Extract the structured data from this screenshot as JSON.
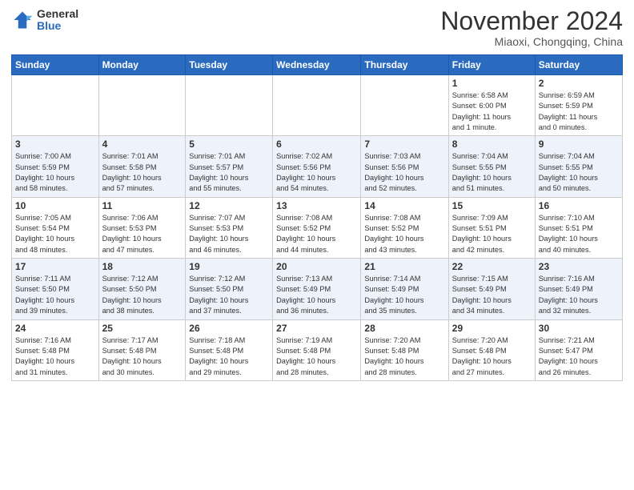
{
  "header": {
    "logo_general": "General",
    "logo_blue": "Blue",
    "title": "November 2024",
    "location": "Miaoxi, Chongqing, China"
  },
  "weekdays": [
    "Sunday",
    "Monday",
    "Tuesday",
    "Wednesday",
    "Thursday",
    "Friday",
    "Saturday"
  ],
  "weeks": [
    [
      {
        "day": "",
        "info": ""
      },
      {
        "day": "",
        "info": ""
      },
      {
        "day": "",
        "info": ""
      },
      {
        "day": "",
        "info": ""
      },
      {
        "day": "",
        "info": ""
      },
      {
        "day": "1",
        "info": "Sunrise: 6:58 AM\nSunset: 6:00 PM\nDaylight: 11 hours\nand 1 minute."
      },
      {
        "day": "2",
        "info": "Sunrise: 6:59 AM\nSunset: 5:59 PM\nDaylight: 11 hours\nand 0 minutes."
      }
    ],
    [
      {
        "day": "3",
        "info": "Sunrise: 7:00 AM\nSunset: 5:59 PM\nDaylight: 10 hours\nand 58 minutes."
      },
      {
        "day": "4",
        "info": "Sunrise: 7:01 AM\nSunset: 5:58 PM\nDaylight: 10 hours\nand 57 minutes."
      },
      {
        "day": "5",
        "info": "Sunrise: 7:01 AM\nSunset: 5:57 PM\nDaylight: 10 hours\nand 55 minutes."
      },
      {
        "day": "6",
        "info": "Sunrise: 7:02 AM\nSunset: 5:56 PM\nDaylight: 10 hours\nand 54 minutes."
      },
      {
        "day": "7",
        "info": "Sunrise: 7:03 AM\nSunset: 5:56 PM\nDaylight: 10 hours\nand 52 minutes."
      },
      {
        "day": "8",
        "info": "Sunrise: 7:04 AM\nSunset: 5:55 PM\nDaylight: 10 hours\nand 51 minutes."
      },
      {
        "day": "9",
        "info": "Sunrise: 7:04 AM\nSunset: 5:55 PM\nDaylight: 10 hours\nand 50 minutes."
      }
    ],
    [
      {
        "day": "10",
        "info": "Sunrise: 7:05 AM\nSunset: 5:54 PM\nDaylight: 10 hours\nand 48 minutes."
      },
      {
        "day": "11",
        "info": "Sunrise: 7:06 AM\nSunset: 5:53 PM\nDaylight: 10 hours\nand 47 minutes."
      },
      {
        "day": "12",
        "info": "Sunrise: 7:07 AM\nSunset: 5:53 PM\nDaylight: 10 hours\nand 46 minutes."
      },
      {
        "day": "13",
        "info": "Sunrise: 7:08 AM\nSunset: 5:52 PM\nDaylight: 10 hours\nand 44 minutes."
      },
      {
        "day": "14",
        "info": "Sunrise: 7:08 AM\nSunset: 5:52 PM\nDaylight: 10 hours\nand 43 minutes."
      },
      {
        "day": "15",
        "info": "Sunrise: 7:09 AM\nSunset: 5:51 PM\nDaylight: 10 hours\nand 42 minutes."
      },
      {
        "day": "16",
        "info": "Sunrise: 7:10 AM\nSunset: 5:51 PM\nDaylight: 10 hours\nand 40 minutes."
      }
    ],
    [
      {
        "day": "17",
        "info": "Sunrise: 7:11 AM\nSunset: 5:50 PM\nDaylight: 10 hours\nand 39 minutes."
      },
      {
        "day": "18",
        "info": "Sunrise: 7:12 AM\nSunset: 5:50 PM\nDaylight: 10 hours\nand 38 minutes."
      },
      {
        "day": "19",
        "info": "Sunrise: 7:12 AM\nSunset: 5:50 PM\nDaylight: 10 hours\nand 37 minutes."
      },
      {
        "day": "20",
        "info": "Sunrise: 7:13 AM\nSunset: 5:49 PM\nDaylight: 10 hours\nand 36 minutes."
      },
      {
        "day": "21",
        "info": "Sunrise: 7:14 AM\nSunset: 5:49 PM\nDaylight: 10 hours\nand 35 minutes."
      },
      {
        "day": "22",
        "info": "Sunrise: 7:15 AM\nSunset: 5:49 PM\nDaylight: 10 hours\nand 34 minutes."
      },
      {
        "day": "23",
        "info": "Sunrise: 7:16 AM\nSunset: 5:49 PM\nDaylight: 10 hours\nand 32 minutes."
      }
    ],
    [
      {
        "day": "24",
        "info": "Sunrise: 7:16 AM\nSunset: 5:48 PM\nDaylight: 10 hours\nand 31 minutes."
      },
      {
        "day": "25",
        "info": "Sunrise: 7:17 AM\nSunset: 5:48 PM\nDaylight: 10 hours\nand 30 minutes."
      },
      {
        "day": "26",
        "info": "Sunrise: 7:18 AM\nSunset: 5:48 PM\nDaylight: 10 hours\nand 29 minutes."
      },
      {
        "day": "27",
        "info": "Sunrise: 7:19 AM\nSunset: 5:48 PM\nDaylight: 10 hours\nand 28 minutes."
      },
      {
        "day": "28",
        "info": "Sunrise: 7:20 AM\nSunset: 5:48 PM\nDaylight: 10 hours\nand 28 minutes."
      },
      {
        "day": "29",
        "info": "Sunrise: 7:20 AM\nSunset: 5:48 PM\nDaylight: 10 hours\nand 27 minutes."
      },
      {
        "day": "30",
        "info": "Sunrise: 7:21 AM\nSunset: 5:47 PM\nDaylight: 10 hours\nand 26 minutes."
      }
    ]
  ]
}
